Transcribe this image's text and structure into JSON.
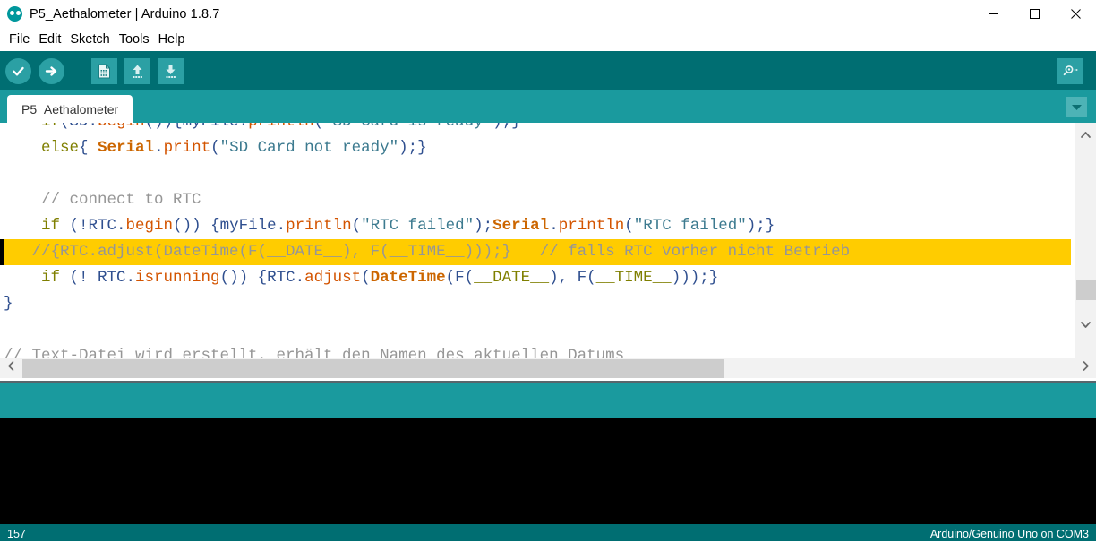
{
  "window": {
    "title": "P5_Aethalometer | Arduino 1.8.7",
    "logo_icon": "arduino-logo-icon",
    "controls": [
      {
        "name": "minimize-button",
        "icon": "minimize-icon"
      },
      {
        "name": "maximize-button",
        "icon": "maximize-icon"
      },
      {
        "name": "close-button",
        "icon": "close-icon"
      }
    ]
  },
  "menubar": {
    "items": [
      {
        "label": "File"
      },
      {
        "label": "Edit"
      },
      {
        "label": "Sketch"
      },
      {
        "label": "Tools"
      },
      {
        "label": "Help"
      }
    ]
  },
  "toolbar": {
    "background": "#006e72",
    "button_background": "#2ba0a4",
    "buttons": [
      {
        "name": "verify-button",
        "icon": "checkmark-circle-icon",
        "tooltip": "Verify"
      },
      {
        "name": "upload-button",
        "icon": "arrow-right-circle-icon",
        "tooltip": "Upload"
      },
      {
        "name": "new-button",
        "icon": "new-document-icon",
        "tooltip": "New"
      },
      {
        "name": "open-button",
        "icon": "arrow-up-icon",
        "tooltip": "Open"
      },
      {
        "name": "save-button",
        "icon": "arrow-down-icon",
        "tooltip": "Save"
      }
    ],
    "serial_monitor": {
      "name": "serial-monitor-button",
      "icon": "magnifier-icon",
      "tooltip": "Serial Monitor"
    }
  },
  "tabbar": {
    "background": "#1a9a9e",
    "tabs": [
      {
        "label": "P5_Aethalometer",
        "active": true
      }
    ],
    "menu_button": {
      "name": "tab-menu-button",
      "icon": "chevron-down-icon"
    }
  },
  "editor": {
    "lines": [
      {
        "id": "line-clipped",
        "highlight": false,
        "clipped": true,
        "tokens": [
          {
            "text": "    ",
            "style": "plain"
          },
          {
            "text": "if",
            "style": "kw"
          },
          {
            "text": "(SD.",
            "style": "punct"
          },
          {
            "text": "begin",
            "style": "func"
          },
          {
            "text": "()){myFile.",
            "style": "punct"
          },
          {
            "text": "println",
            "style": "func"
          },
          {
            "text": "(",
            "style": "punct"
          },
          {
            "text": "\"SD Card is ready\"",
            "style": "str"
          },
          {
            "text": ");}",
            "style": "punct"
          }
        ]
      },
      {
        "id": "line-else-serial-print",
        "highlight": false,
        "tokens": [
          {
            "text": "    ",
            "style": "plain"
          },
          {
            "text": "else",
            "style": "kw"
          },
          {
            "text": "{ ",
            "style": "punct"
          },
          {
            "text": "Serial",
            "style": "kw2"
          },
          {
            "text": ".",
            "style": "punct"
          },
          {
            "text": "print",
            "style": "func"
          },
          {
            "text": "(",
            "style": "punct"
          },
          {
            "text": "\"SD Card not ready\"",
            "style": "str"
          },
          {
            "text": ");}",
            "style": "punct"
          }
        ]
      },
      {
        "id": "line-blank-1",
        "highlight": false,
        "tokens": [
          {
            "text": " ",
            "style": "plain"
          }
        ]
      },
      {
        "id": "line-comment-connect-rtc",
        "highlight": false,
        "tokens": [
          {
            "text": "    ",
            "style": "plain"
          },
          {
            "text": "// connect to RTC",
            "style": "comment"
          }
        ]
      },
      {
        "id": "line-if-rtc-begin",
        "highlight": false,
        "tokens": [
          {
            "text": "    ",
            "style": "plain"
          },
          {
            "text": "if",
            "style": "kw"
          },
          {
            "text": " (!RTC.",
            "style": "punct"
          },
          {
            "text": "begin",
            "style": "func"
          },
          {
            "text": "()) {myFile.",
            "style": "punct"
          },
          {
            "text": "println",
            "style": "func"
          },
          {
            "text": "(",
            "style": "punct"
          },
          {
            "text": "\"RTC failed\"",
            "style": "str"
          },
          {
            "text": ");",
            "style": "punct"
          },
          {
            "text": "Serial",
            "style": "kw2"
          },
          {
            "text": ".",
            "style": "punct"
          },
          {
            "text": "println",
            "style": "func"
          },
          {
            "text": "(",
            "style": "punct"
          },
          {
            "text": "\"RTC failed\"",
            "style": "str"
          },
          {
            "text": ");}",
            "style": "punct"
          }
        ]
      },
      {
        "id": "line-rtc-adjust-commented",
        "highlight": true,
        "tokens": [
          {
            "text": "   //{RTC.adjust(DateTime(F(__DATE__), F(__TIME__)));}   // falls RTC vorher nicht Betrieb",
            "style": "comment-hl"
          }
        ]
      },
      {
        "id": "line-if-rtc-isrunning",
        "highlight": false,
        "tokens": [
          {
            "text": "    ",
            "style": "plain"
          },
          {
            "text": "if",
            "style": "kw"
          },
          {
            "text": " (! RTC.",
            "style": "punct"
          },
          {
            "text": "isrunning",
            "style": "func"
          },
          {
            "text": "()) {RTC.",
            "style": "punct"
          },
          {
            "text": "adjust",
            "style": "func"
          },
          {
            "text": "(",
            "style": "punct"
          },
          {
            "text": "DateTime",
            "style": "kw2"
          },
          {
            "text": "(F(",
            "style": "punct"
          },
          {
            "text": "__DATE__",
            "style": "const"
          },
          {
            "text": "), F(",
            "style": "punct"
          },
          {
            "text": "__TIME__",
            "style": "const"
          },
          {
            "text": ")));}",
            "style": "punct"
          }
        ]
      },
      {
        "id": "line-close-brace",
        "highlight": false,
        "tokens": [
          {
            "text": "}",
            "style": "punct"
          }
        ]
      },
      {
        "id": "line-blank-2",
        "highlight": false,
        "tokens": [
          {
            "text": " ",
            "style": "plain"
          }
        ]
      },
      {
        "id": "line-comment-textdatei",
        "highlight": false,
        "tokens": [
          {
            "text": "// Text-Datei wird erstellt, erhält den Namen des aktuellen Datums",
            "style": "comment"
          }
        ]
      }
    ],
    "highlight_color": "#ffcc00",
    "background": "#ffffff"
  },
  "scrollbars": {
    "vertical": {
      "up_icon": "chevron-up-icon",
      "down_icon": "chevron-down-icon"
    },
    "horizontal": {
      "left_icon": "chevron-left-icon",
      "right_icon": "chevron-right-icon"
    }
  },
  "console": {
    "background": "#000000",
    "text": ""
  },
  "statusbar": {
    "line_number": "157",
    "board_info": "Arduino/Genuino Uno on COM3",
    "background": "#006e72"
  }
}
